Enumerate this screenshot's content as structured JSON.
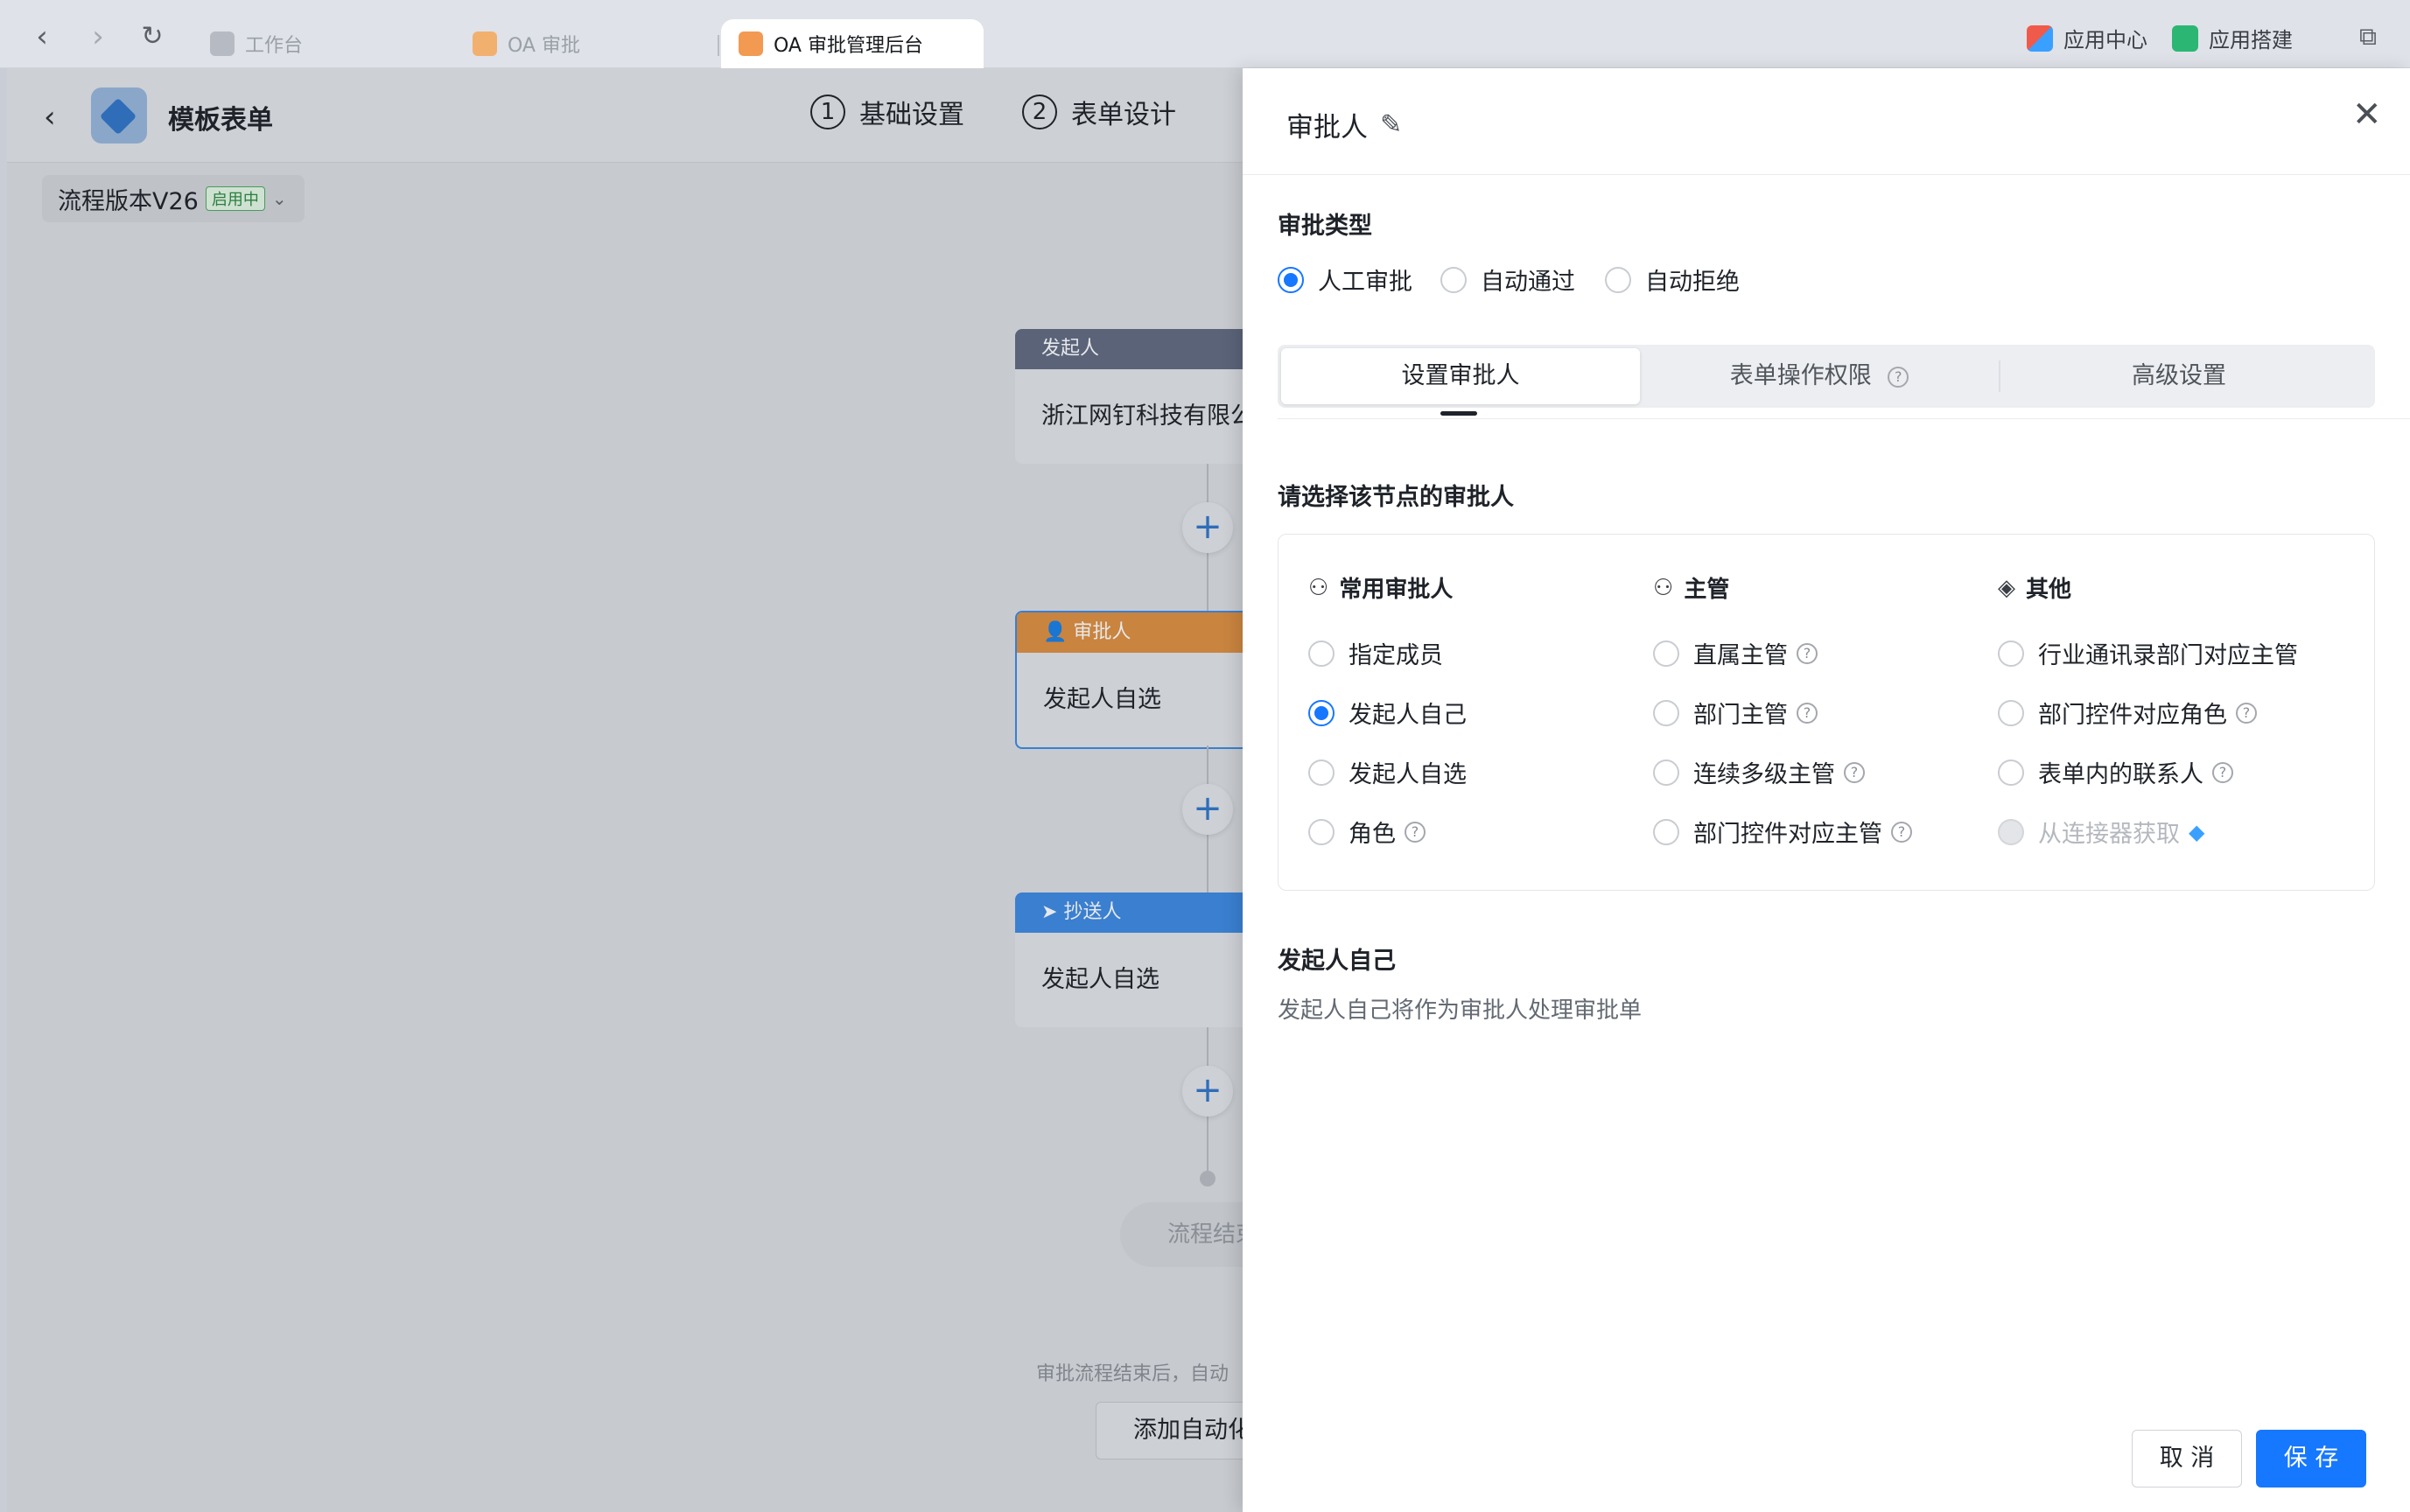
{
  "browser": {
    "tabs": [
      {
        "label": "工作台"
      },
      {
        "label": "OA 审批"
      },
      {
        "label": "OA 审批管理后台"
      }
    ],
    "right_actions": {
      "app_center": "应用中心",
      "app_build": "应用搭建"
    }
  },
  "header": {
    "title": "模板表单",
    "steps": [
      {
        "num": "1",
        "label": "基础设置"
      },
      {
        "num": "2",
        "label": "表单设计"
      }
    ]
  },
  "version": {
    "label": "流程版本V26",
    "badge": "启用中"
  },
  "flow": {
    "nodes": [
      {
        "head": "发起人",
        "body": "浙江网钉科技有限公"
      },
      {
        "head": "审批人",
        "body": "发起人自选"
      },
      {
        "head": "抄送人",
        "body": "发起人自选"
      }
    ],
    "end_label": "流程结束",
    "footer_note": "审批流程结束后，自动",
    "add_automation": "添加自动化"
  },
  "drawer": {
    "title": "审批人",
    "approval_type_label": "审批类型",
    "approval_types": [
      {
        "label": "人工审批",
        "selected": true
      },
      {
        "label": "自动通过",
        "selected": false
      },
      {
        "label": "自动拒绝",
        "selected": false
      }
    ],
    "tabs": [
      {
        "label": "设置审批人",
        "active": true
      },
      {
        "label": "表单操作权限",
        "active": false
      },
      {
        "label": "高级设置",
        "active": false
      }
    ],
    "select_label": "请选择该节点的审批人",
    "columns": [
      {
        "title": "常用审批人",
        "icon": "user-icon",
        "options": [
          {
            "label": "指定成员",
            "selected": false,
            "help": false
          },
          {
            "label": "发起人自己",
            "selected": true,
            "help": false
          },
          {
            "label": "发起人自选",
            "selected": false,
            "help": false
          },
          {
            "label": "角色",
            "selected": false,
            "help": true
          }
        ]
      },
      {
        "title": "主管",
        "icon": "supervisor-icon",
        "options": [
          {
            "label": "直属主管",
            "selected": false,
            "help": true
          },
          {
            "label": "部门主管",
            "selected": false,
            "help": true
          },
          {
            "label": "连续多级主管",
            "selected": false,
            "help": true
          },
          {
            "label": "部门控件对应主管",
            "selected": false,
            "help": true
          }
        ]
      },
      {
        "title": "其他",
        "icon": "layers-icon",
        "options": [
          {
            "label": "行业通讯录部门对应主管",
            "selected": false,
            "help": false
          },
          {
            "label": "部门控件对应角色",
            "selected": false,
            "help": true
          },
          {
            "label": "表单内的联系人",
            "selected": false,
            "help": true
          },
          {
            "label": "从连接器获取",
            "selected": false,
            "help": false,
            "disabled": true
          }
        ]
      }
    ],
    "description_title": "发起人自己",
    "description_text": "发起人自己将作为审批人处理审批单",
    "cancel_label": "取 消",
    "save_label": "保 存"
  },
  "colors": {
    "accent": "#1677ff",
    "approver_node": "#c9843f",
    "cc_node": "#3a7fd0",
    "initiator_node": "#5a6378"
  }
}
